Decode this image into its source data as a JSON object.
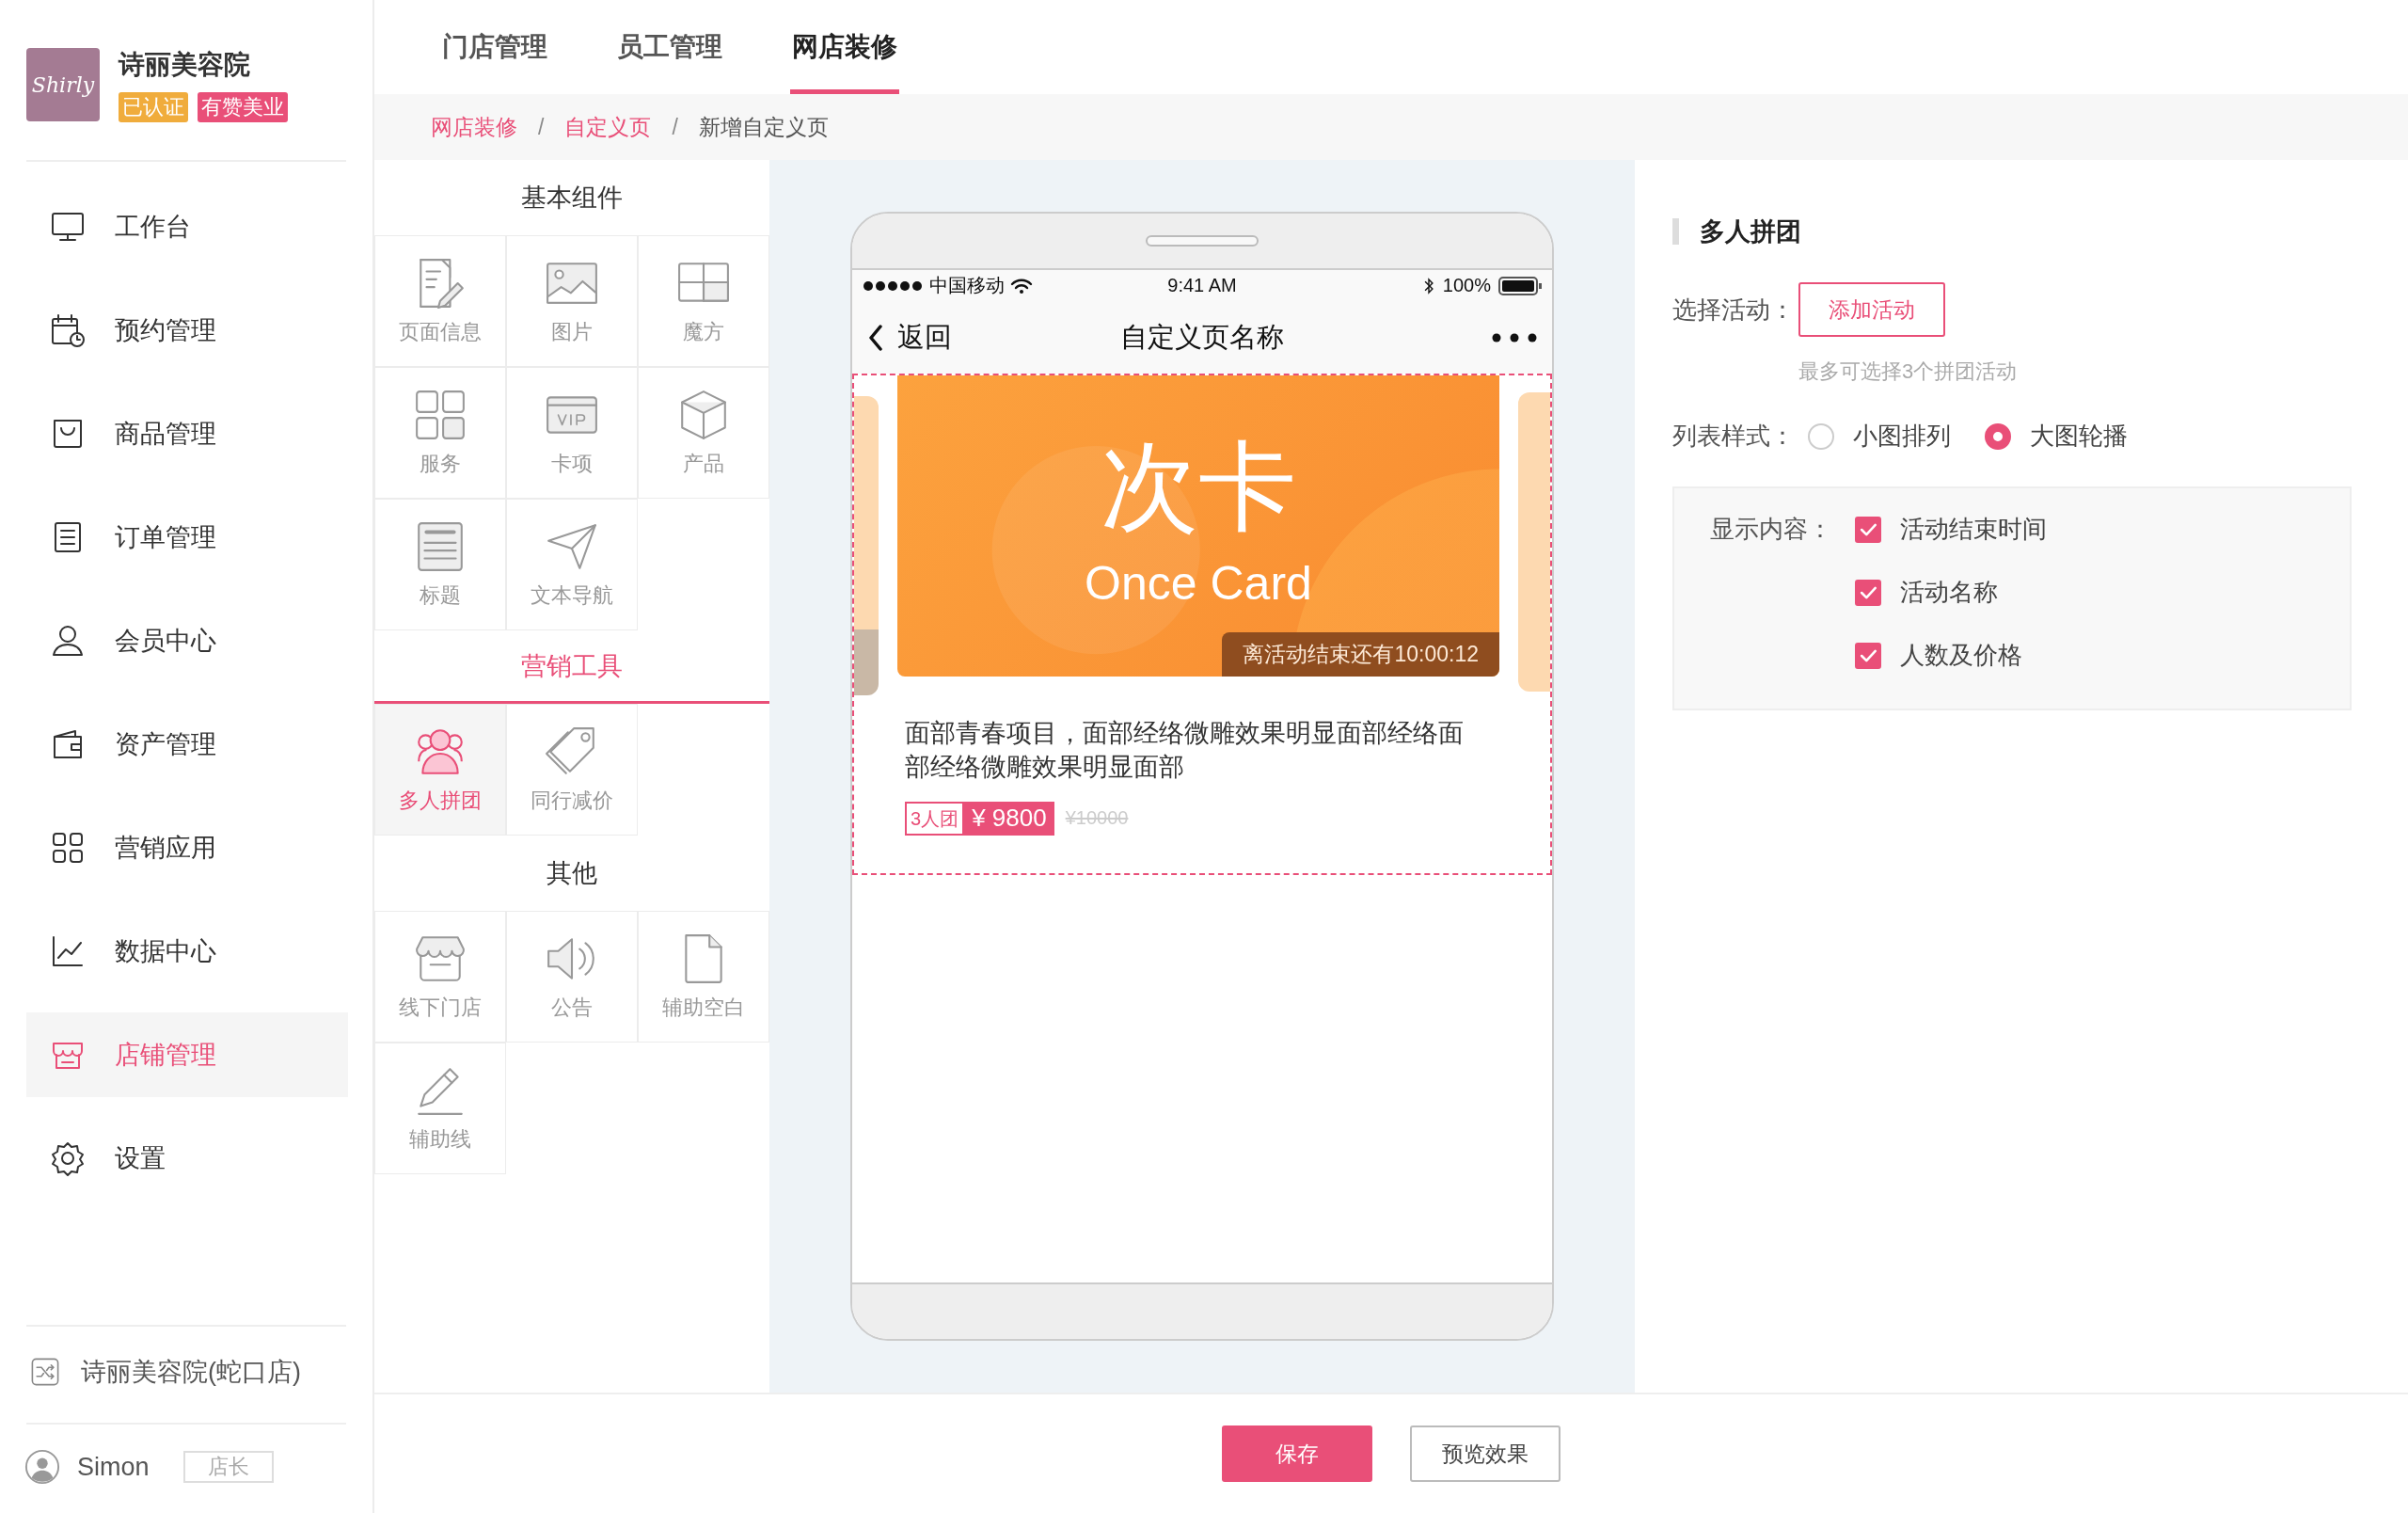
{
  "sidebar": {
    "logo_text": "Shirly",
    "shop_name": "诗丽美容院",
    "badges": [
      {
        "label": "已认证",
        "color": "#f0ac3c"
      },
      {
        "label": "有赞美业",
        "color": "#e94f78"
      }
    ],
    "items": [
      {
        "label": "工作台",
        "kind": "monitor",
        "selected": false
      },
      {
        "label": "预约管理",
        "kind": "calendar",
        "selected": false
      },
      {
        "label": "商品管理",
        "kind": "bag",
        "selected": false
      },
      {
        "label": "订单管理",
        "kind": "list",
        "selected": false
      },
      {
        "label": "会员中心",
        "kind": "user",
        "selected": false
      },
      {
        "label": "资产管理",
        "kind": "wallet",
        "selected": false
      },
      {
        "label": "营销应用",
        "kind": "grid",
        "selected": false
      },
      {
        "label": "数据中心",
        "kind": "chart",
        "selected": false
      },
      {
        "label": "店铺管理",
        "kind": "store",
        "selected": true
      },
      {
        "label": "设置",
        "kind": "gear",
        "selected": false
      }
    ],
    "store_switch": "诗丽美容院(蛇口店)",
    "user": {
      "name": "Simon",
      "role": "店长"
    }
  },
  "tabs": [
    {
      "label": "门店管理",
      "selected": false
    },
    {
      "label": "员工管理",
      "selected": false
    },
    {
      "label": "网店装修",
      "selected": true
    }
  ],
  "breadcrumb_separator": "/",
  "breadcrumb": [
    {
      "label": "网店装修",
      "current": false
    },
    {
      "label": "自定义页",
      "current": false
    },
    {
      "label": "新增自定义页",
      "current": true
    }
  ],
  "components": [
    {
      "title": "基本组件",
      "selected": false,
      "items": [
        {
          "label": "页面信息",
          "kind": "page",
          "selected": false
        },
        {
          "label": "图片",
          "kind": "image",
          "selected": false
        },
        {
          "label": "魔方",
          "kind": "layout",
          "selected": false
        },
        {
          "label": "服务",
          "kind": "grid",
          "selected": false
        },
        {
          "label": "卡项",
          "kind": "vip",
          "selected": false
        },
        {
          "label": "产品",
          "kind": "cube",
          "selected": false
        },
        {
          "label": "标题",
          "kind": "title",
          "selected": false
        },
        {
          "label": "文本导航",
          "kind": "send",
          "selected": false
        }
      ]
    },
    {
      "title": "营销工具",
      "selected": true,
      "items": [
        {
          "label": "多人拼团",
          "kind": "group",
          "selected": true
        },
        {
          "label": "同行减价",
          "kind": "tag",
          "selected": false
        }
      ]
    },
    {
      "title": "其他",
      "selected": false,
      "items": [
        {
          "label": "线下门店",
          "kind": "store",
          "selected": false
        },
        {
          "label": "公告",
          "kind": "speaker",
          "selected": false
        },
        {
          "label": "辅助空白",
          "kind": "file",
          "selected": false
        },
        {
          "label": "辅助线",
          "kind": "pencil",
          "selected": false
        }
      ]
    }
  ],
  "phone": {
    "carrier": "中国移动",
    "time": "9:41 AM",
    "battery": "100%",
    "back": "返回",
    "title": "自定义页名称",
    "card": {
      "heading": "次卡",
      "subtitle": "Once Card",
      "countdown": "离活动结束还有10:00:12",
      "description": "面部青春项目，面部经络微雕效果明显面部经络面部经络微雕效果明显面部",
      "group_size": "3人团",
      "price": "¥ 9800",
      "original_price": "¥10000"
    }
  },
  "settings": {
    "title": "多人拼团",
    "activity_label": "选择活动：",
    "add_button": "添加活动",
    "hint": "最多可选择3个拼团活动",
    "style_label": "列表样式：",
    "styles": [
      {
        "label": "小图排列",
        "selected": false
      },
      {
        "label": "大图轮播",
        "selected": true
      }
    ],
    "display_label": "显示内容：",
    "display": [
      {
        "label": "活动结束时间",
        "checked": true
      },
      {
        "label": "活动名称",
        "checked": true
      },
      {
        "label": "人数及价格",
        "checked": true
      }
    ]
  },
  "footer": {
    "save": "保存",
    "preview": "预览效果"
  }
}
